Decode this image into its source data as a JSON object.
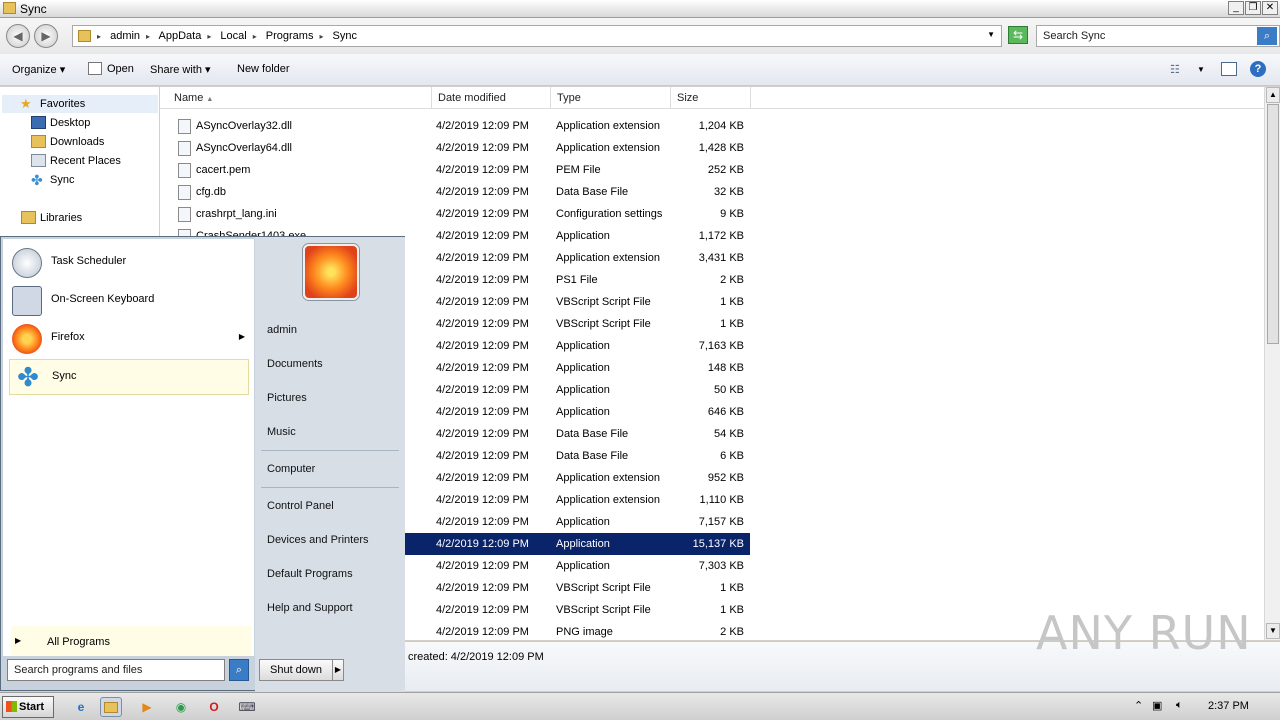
{
  "window": {
    "title": "Sync"
  },
  "address": {
    "crumbs": [
      "admin",
      "AppData",
      "Local",
      "Programs",
      "Sync"
    ],
    "search_placeholder": "Search Sync"
  },
  "toolbar": {
    "organize": "Organize",
    "open": "Open",
    "share_with": "Share with",
    "new_folder": "New folder"
  },
  "nav": {
    "favorites": "Favorites",
    "items": [
      "Desktop",
      "Downloads",
      "Recent Places",
      "Sync"
    ],
    "libraries": "Libraries",
    "partial": "Documents"
  },
  "columns": {
    "name": "Name",
    "date": "Date modified",
    "type": "Type",
    "size": "Size"
  },
  "files": [
    {
      "name": "ASyncOverlay32.dll",
      "date": "4/2/2019 12:09 PM",
      "type": "Application extension",
      "size": "1,204 KB"
    },
    {
      "name": "ASyncOverlay64.dll",
      "date": "4/2/2019 12:09 PM",
      "type": "Application extension",
      "size": "1,428 KB"
    },
    {
      "name": "cacert.pem",
      "date": "4/2/2019 12:09 PM",
      "type": "PEM File",
      "size": "252 KB"
    },
    {
      "name": "cfg.db",
      "date": "4/2/2019 12:09 PM",
      "type": "Data Base File",
      "size": "32 KB"
    },
    {
      "name": "crashrpt_lang.ini",
      "date": "4/2/2019 12:09 PM",
      "type": "Configuration settings",
      "size": "9 KB"
    },
    {
      "name": "CrashSender1403.exe",
      "date": "4/2/2019 12:09 PM",
      "type": "Application",
      "size": "1,172 KB"
    },
    {
      "name": "",
      "date": "4/2/2019 12:09 PM",
      "type": "Application extension",
      "size": "3,431 KB"
    },
    {
      "name": "",
      "date": "4/2/2019 12:09 PM",
      "type": "PS1 File",
      "size": "2 KB"
    },
    {
      "name": "",
      "date": "4/2/2019 12:09 PM",
      "type": "VBScript Script File",
      "size": "1 KB"
    },
    {
      "name": "",
      "date": "4/2/2019 12:09 PM",
      "type": "VBScript Script File",
      "size": "1 KB"
    },
    {
      "name": "",
      "date": "4/2/2019 12:09 PM",
      "type": "Application",
      "size": "7,163 KB"
    },
    {
      "name": "",
      "date": "4/2/2019 12:09 PM",
      "type": "Application",
      "size": "148 KB"
    },
    {
      "name": "",
      "date": "4/2/2019 12:09 PM",
      "type": "Application",
      "size": "50 KB"
    },
    {
      "name": "",
      "date": "4/2/2019 12:09 PM",
      "type": "Application",
      "size": "646 KB"
    },
    {
      "name": "",
      "date": "4/2/2019 12:09 PM",
      "type": "Data Base File",
      "size": "54 KB"
    },
    {
      "name": "",
      "date": "4/2/2019 12:09 PM",
      "type": "Data Base File",
      "size": "6 KB"
    },
    {
      "name": "",
      "date": "4/2/2019 12:09 PM",
      "type": "Application extension",
      "size": "952 KB"
    },
    {
      "name": "",
      "date": "4/2/2019 12:09 PM",
      "type": "Application extension",
      "size": "1,110 KB"
    },
    {
      "name": "",
      "date": "4/2/2019 12:09 PM",
      "type": "Application",
      "size": "7,157 KB"
    },
    {
      "name": "",
      "date": "4/2/2019 12:09 PM",
      "type": "Application",
      "size": "15,137 KB",
      "selected": true
    },
    {
      "name": "",
      "date": "4/2/2019 12:09 PM",
      "type": "Application",
      "size": "7,303 KB"
    },
    {
      "name": "",
      "date": "4/2/2019 12:09 PM",
      "type": "VBScript Script File",
      "size": "1 KB"
    },
    {
      "name": "",
      "date": "4/2/2019 12:09 PM",
      "type": "VBScript Script File",
      "size": "1 KB"
    },
    {
      "name": "",
      "date": "4/2/2019 12:09 PM",
      "type": "PNG image",
      "size": "2 KB"
    }
  ],
  "details": {
    "text": "created: 4/2/2019 12:09 PM"
  },
  "start_menu": {
    "programs": [
      "Task Scheduler",
      "On-Screen Keyboard",
      "Firefox",
      "Sync"
    ],
    "all_programs": "All Programs",
    "search_placeholder": "Search programs and files",
    "links": [
      "admin",
      "Documents",
      "Pictures",
      "Music",
      "Computer",
      "Control Panel",
      "Devices and Printers",
      "Default Programs",
      "Help and Support"
    ],
    "shutdown": "Shut down"
  },
  "taskbar": {
    "start": "Start",
    "clock": "2:37 PM"
  },
  "watermark": "ANY RUN",
  "colors": {
    "selection": "#0a246a",
    "accent": "#3b7cc6"
  }
}
